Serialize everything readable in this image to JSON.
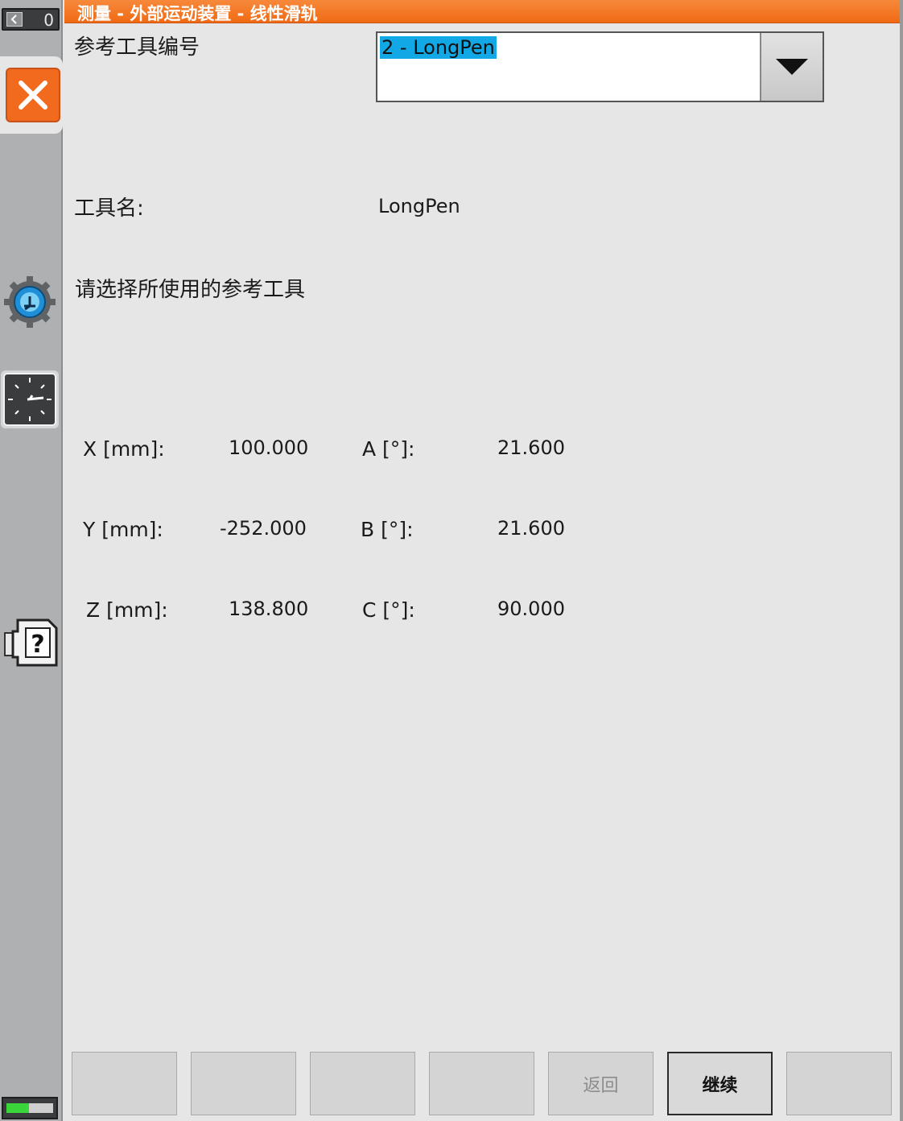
{
  "title_bar": {
    "title": "测量 - 外部运动装置 - 线性滑轨"
  },
  "status": {
    "count": "0"
  },
  "form": {
    "ref_tool_label": "参考工具编号",
    "ref_tool_selected": "2 - LongPen",
    "tool_name_label": "工具名:",
    "tool_name_value": "LongPen",
    "instruction": "请选择所使用的参考工具"
  },
  "coordinates": {
    "x_label": "X [mm]:",
    "x_value": "100.000",
    "y_label": "Y [mm]:",
    "y_value": "-252.000",
    "z_label": "Z [mm]:",
    "z_value": "138.800",
    "a_label": "A [°]:",
    "a_value": "21.600",
    "b_label": "B [°]:",
    "b_value": "21.600",
    "c_label": "C [°]:",
    "c_value": "90.000"
  },
  "softkeys": {
    "key1": "",
    "key2": "",
    "key3": "",
    "key4": "",
    "back": "返回",
    "continue": "继续",
    "key7": ""
  },
  "colors": {
    "title_bar": "#f06a14",
    "close_button": "#f26a1d",
    "selection_highlight": "#12a8e6",
    "battery_fill": "#3ad63a"
  },
  "icons": {
    "close": "close-icon",
    "gear": "gear-icon",
    "clock": "clock-icon",
    "help": "help-icon",
    "dropdown": "chevron-down-icon",
    "battery": "battery-icon"
  }
}
